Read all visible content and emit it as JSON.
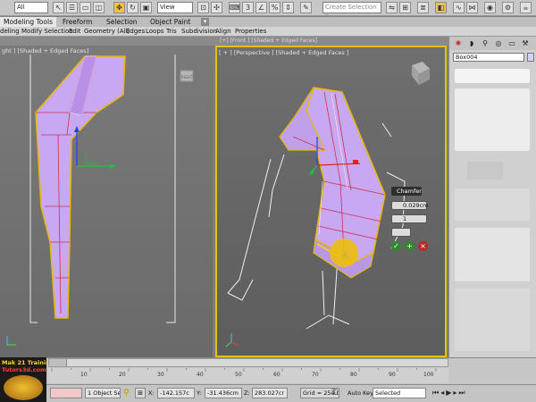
{
  "toolbar": {
    "selection_filter": "All",
    "view_dropdown": "View",
    "named_selection_placeholder": "Create Selection Se"
  },
  "ribbon": {
    "tabs": [
      "Modeling Tools",
      "Freeform",
      "Selection",
      "Object Paint"
    ],
    "subitems": [
      "deling",
      "Modify Selection",
      "Edit",
      "Geometry (All)",
      "Edges",
      "Loops",
      "Tris",
      "Subdivision",
      "Align",
      "Properties"
    ]
  },
  "viewports": {
    "top_left_label": "[+] [Front ] [Shaded + Edged Faces]",
    "left_label": "ght ] [Shaded + Edged Faces]",
    "right_label": "[ + ] [Perspective ] [Shaded + Edged Faces ]"
  },
  "command_panel": {
    "object_name": "Box004",
    "object_color": "#d2d2ff"
  },
  "caddy": {
    "title": "Chamfer",
    "amount": "0.029cm",
    "segments": "1",
    "ok_icon": "check-icon",
    "add_icon": "plus-icon",
    "cancel_icon": "x-icon"
  },
  "timeline": {
    "ticks": [
      "10",
      "20",
      "30",
      "40",
      "50",
      "60",
      "70",
      "80",
      "90",
      "100"
    ]
  },
  "status": {
    "selection": "1 Object Selec",
    "x_label": "X:",
    "x_value": "-142.157c",
    "y_label": "Y:",
    "y_value": "-31.436cm",
    "z_label": "Z:",
    "z_value": "283.027cr",
    "grid": "Grid = 254.0cm",
    "auto_key": "Auto Key",
    "selected": "Selected"
  },
  "logo": {
    "line1": "Mak 21 Training",
    "line2": "Tutors3d.com"
  },
  "colors": {
    "active_viewport_border": "#e8c200",
    "selection_edge": "#e8b800",
    "mesh_fill": "#c8a8f0",
    "edge_red": "#d03050"
  }
}
